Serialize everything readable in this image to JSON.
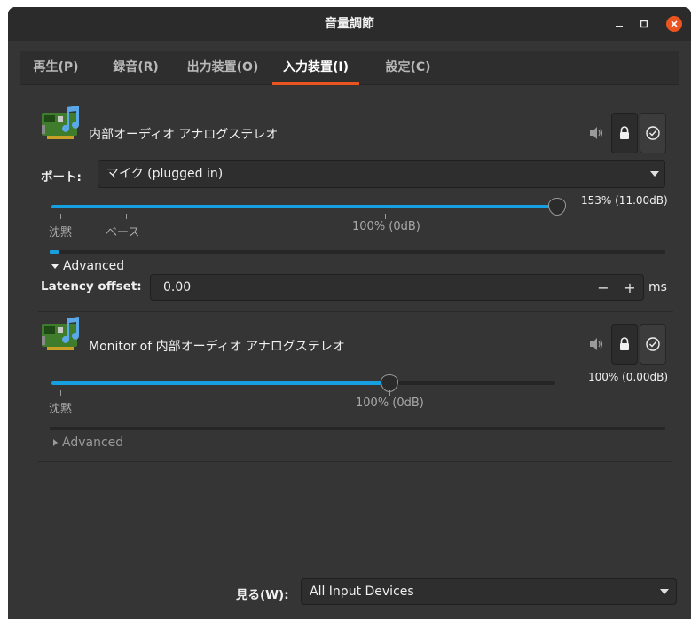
{
  "window": {
    "title": "音量調節"
  },
  "tabs": [
    {
      "label": "再生(P)"
    },
    {
      "label": "録音(R)"
    },
    {
      "label": "出力装置(O)"
    },
    {
      "label": "入力装置(I)",
      "active": true
    },
    {
      "label": "設定(C)"
    }
  ],
  "devices": [
    {
      "name": "内部オーディオ アナログステレオ",
      "port_label": "ポート:",
      "port_value": "マイク (plugged in)",
      "volume_percent": 153,
      "volume_label": "153% (11.00dB)",
      "marks": {
        "silence": "沈黙",
        "base": "ベース",
        "hundred": "100% (0dB)"
      },
      "level_fraction": 0.015,
      "advanced": {
        "label": "Advanced",
        "expanded": true
      },
      "latency": {
        "label": "Latency offset:",
        "value": "0.00",
        "unit": "ms"
      }
    },
    {
      "name": "Monitor of 内部オーディオ アナログステレオ",
      "volume_percent": 100,
      "volume_label": "100% (0.00dB)",
      "marks": {
        "silence": "沈黙",
        "hundred": "100% (0dB)"
      },
      "level_fraction": 0,
      "advanced": {
        "label": "Advanced",
        "expanded": false
      }
    }
  ],
  "footer": {
    "show_label": "見る(W):",
    "show_value": "All Input Devices"
  },
  "colors": {
    "accent": "#e95420",
    "slider": "#16a0e0",
    "window_bg": "#353535"
  },
  "icons": [
    "sound-card-icon",
    "speaker-icon",
    "lock-icon",
    "check-circle-icon",
    "dropdown-arrow-icon"
  ]
}
